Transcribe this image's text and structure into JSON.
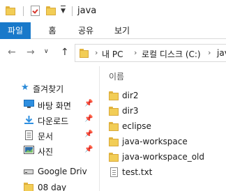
{
  "window": {
    "title": "java"
  },
  "ribbon": {
    "tabs": [
      "파일",
      "홈",
      "공유",
      "보기"
    ],
    "active_tab": "파일"
  },
  "address": {
    "crumbs": [
      "내 PC",
      "로컬 디스크 (C:)",
      "java"
    ],
    "separator": "›"
  },
  "nav_pane": {
    "quick_access": "즐겨찾기",
    "items": [
      {
        "label": "바탕 화면",
        "icon": "desktop-icon",
        "pinned": true
      },
      {
        "label": "다운로드",
        "icon": "download-icon",
        "pinned": true
      },
      {
        "label": "문서",
        "icon": "document-icon",
        "pinned": true
      },
      {
        "label": "사진",
        "icon": "picture-icon",
        "pinned": true
      },
      {
        "label": "Google Driv",
        "icon": "drive-icon",
        "pinned": false
      },
      {
        "label": "08 day",
        "icon": "folder-icon",
        "pinned": false
      }
    ]
  },
  "file_list": {
    "column_name": "이름",
    "items": [
      {
        "name": "dir2",
        "type": "folder"
      },
      {
        "name": "dir3",
        "type": "folder"
      },
      {
        "name": "eclipse",
        "type": "folder"
      },
      {
        "name": "java-workspace",
        "type": "folder"
      },
      {
        "name": "java-workspace_old",
        "type": "folder"
      },
      {
        "name": "test.txt",
        "type": "file"
      }
    ]
  },
  "colors": {
    "accent": "#1979ca",
    "folder": "#f2cd56"
  }
}
